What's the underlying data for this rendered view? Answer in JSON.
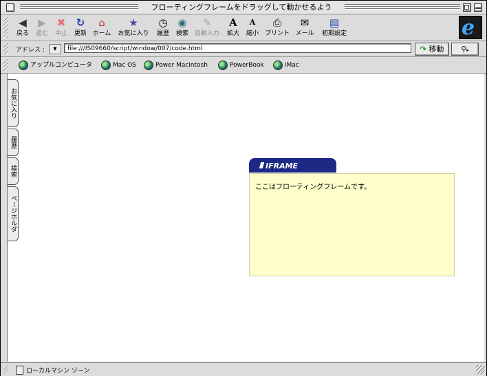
{
  "window": {
    "title": "フローティングフレームをドラッグして動かせるよう"
  },
  "toolbar": {
    "buttons": [
      {
        "label": "戻る",
        "icon": "back-arrow-icon",
        "enabled": true
      },
      {
        "label": "進む",
        "icon": "forward-arrow-icon",
        "enabled": false
      },
      {
        "label": "中止",
        "icon": "stop-icon",
        "enabled": false
      },
      {
        "label": "更新",
        "icon": "refresh-icon",
        "enabled": true
      },
      {
        "label": "ホーム",
        "icon": "home-icon",
        "enabled": true
      },
      {
        "label": "お気に入り",
        "icon": "favorites-icon",
        "enabled": true
      },
      {
        "label": "履歴",
        "icon": "history-icon",
        "enabled": true
      },
      {
        "label": "検索",
        "icon": "search-icon",
        "enabled": true
      },
      {
        "label": "自動入力",
        "icon": "autofill-icon",
        "enabled": false
      },
      {
        "label": "拡大",
        "icon": "text-larger-icon",
        "enabled": true
      },
      {
        "label": "縮小",
        "icon": "text-smaller-icon",
        "enabled": true
      },
      {
        "label": "プリント",
        "icon": "print-icon",
        "enabled": true
      },
      {
        "label": "メール",
        "icon": "mail-icon",
        "enabled": true
      },
      {
        "label": "初期設定",
        "icon": "preferences-icon",
        "enabled": true
      }
    ],
    "logo": "e"
  },
  "address": {
    "label": "アドレス :",
    "value": "file:///IS09660/script/window/007/code.html",
    "go_label": "移動"
  },
  "favorites": [
    {
      "label": "アップルコンピュータ"
    },
    {
      "label": "Mac OS"
    },
    {
      "label": "Power Macintosh"
    },
    {
      "label": "PowerBook"
    },
    {
      "label": "iMac"
    }
  ],
  "side_tabs": [
    {
      "label": "お気に入り"
    },
    {
      "label": "履歴"
    },
    {
      "label": "検索"
    },
    {
      "label": "ページホルダ"
    }
  ],
  "iframe_widget": {
    "tab_label": "IFRAME",
    "content_text": "ここはフローティングフレームです。",
    "colors": {
      "tab": "#1c2a86",
      "panel": "#ffffcc"
    }
  },
  "status": {
    "text": "ローカルマシン ゾーン"
  }
}
